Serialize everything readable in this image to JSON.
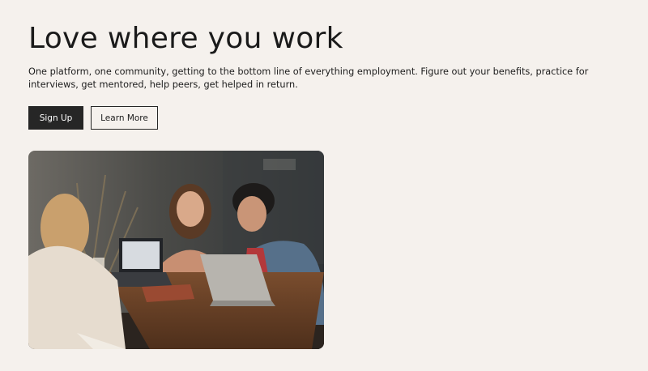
{
  "hero": {
    "title": "Love where you work",
    "description": "One platform, one community, getting to the bottom line of everything employment. Figure out your benefits, practice for interviews, get mentored, help peers, get helped in return.",
    "primary_button": "Sign Up",
    "secondary_button": "Learn More"
  },
  "colors": {
    "background": "#f5f1ed",
    "primary_button_bg": "#262626",
    "text": "#1b1b1b"
  }
}
